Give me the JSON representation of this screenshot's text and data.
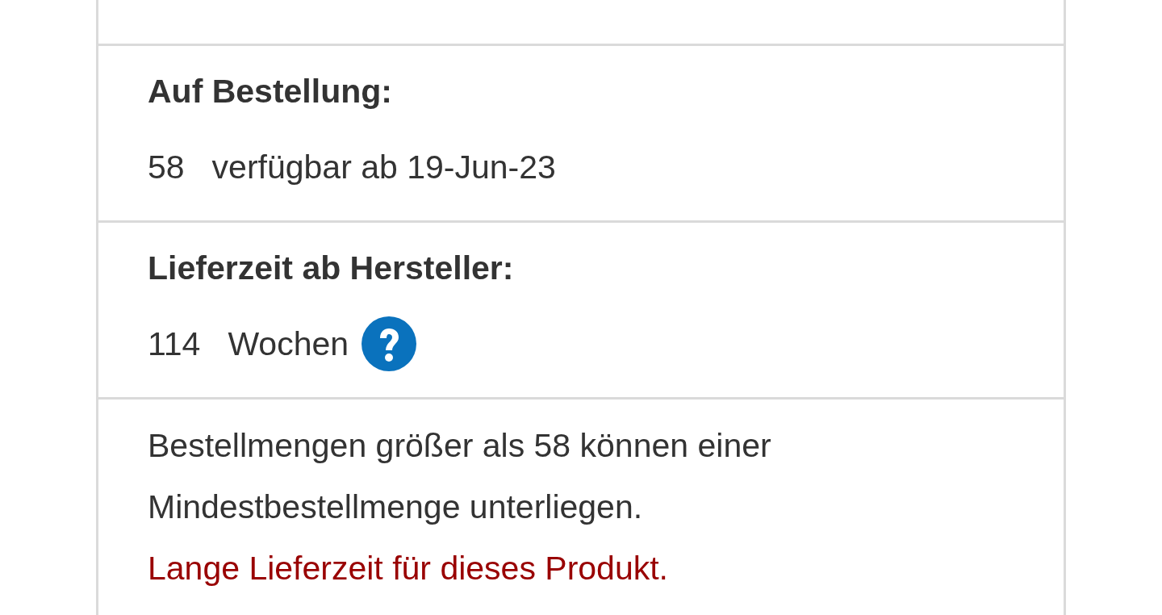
{
  "sections": [
    {
      "heading": "Auf Bestellung:",
      "quantity": "58",
      "text": "verfügbar ab 19-Jun-23",
      "help": false
    },
    {
      "heading": "Lieferzeit ab Hersteller:",
      "quantity": "114",
      "text": "Wochen",
      "help": true
    }
  ],
  "note": {
    "text": "Bestellmengen größer als 58 können einer Mindestbestellmenge unterliegen.",
    "warning": "Lange Lieferzeit für dieses Produkt."
  }
}
